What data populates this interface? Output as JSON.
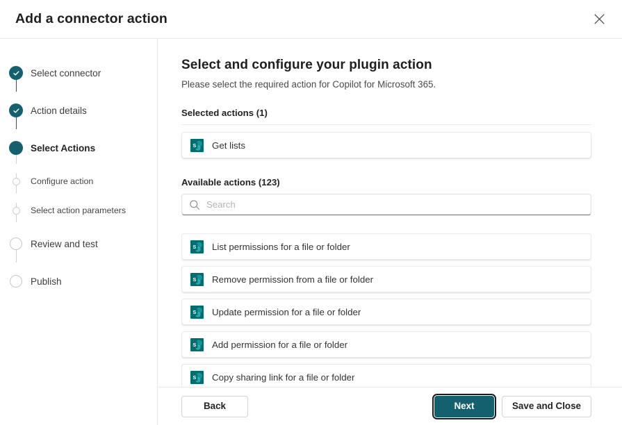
{
  "dialog": {
    "title": "Add a connector action",
    "close_label": "Close"
  },
  "stepper": {
    "steps": [
      {
        "label": "Select connector",
        "state": "done",
        "level": "main"
      },
      {
        "label": "Action details",
        "state": "done",
        "level": "main"
      },
      {
        "label": "Select Actions",
        "state": "current",
        "level": "main"
      },
      {
        "label": "Configure action",
        "state": "todo",
        "level": "sub"
      },
      {
        "label": "Select action parameters",
        "state": "todo",
        "level": "sub"
      },
      {
        "label": "Review and test",
        "state": "todo",
        "level": "main"
      },
      {
        "label": "Publish",
        "state": "todo",
        "level": "main"
      }
    ]
  },
  "main": {
    "heading": "Select and configure your plugin action",
    "subheading": "Please select the required action for Copilot for Microsoft 365.",
    "selected_section_label": "Selected actions (1)",
    "available_section_label": "Available actions (123)",
    "selected_actions": [
      {
        "label": "Get lists",
        "icon": "sharepoint-icon"
      }
    ],
    "search": {
      "placeholder": "Search",
      "value": "",
      "icon": "search-icon"
    },
    "available_actions": [
      {
        "label": "List permissions for a file or folder",
        "icon": "sharepoint-icon"
      },
      {
        "label": "Remove permission from a file or folder",
        "icon": "sharepoint-icon"
      },
      {
        "label": "Update permission for a file or folder",
        "icon": "sharepoint-icon"
      },
      {
        "label": "Add permission for a file or folder",
        "icon": "sharepoint-icon"
      },
      {
        "label": "Copy sharing link for a file or folder",
        "icon": "sharepoint-icon"
      }
    ]
  },
  "footer": {
    "back_label": "Back",
    "next_label": "Next",
    "save_close_label": "Save and Close"
  },
  "colors": {
    "accent": "#15606e",
    "sharepoint_teal": "#0d7a78",
    "sharepoint_dark": "#036c70",
    "text_primary": "#242424",
    "text_secondary": "#4a4a4a",
    "border": "#e8e8e8"
  }
}
